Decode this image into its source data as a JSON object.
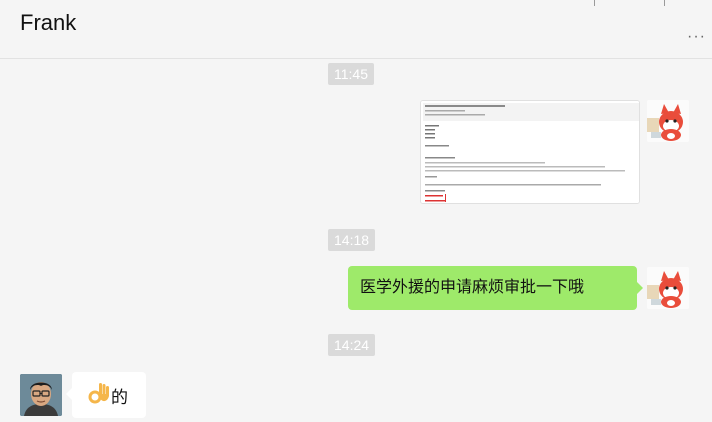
{
  "chat": {
    "title": "Frank",
    "more_icon": "more-dots-icon"
  },
  "messages": [
    {
      "type": "time",
      "text": "11:45"
    },
    {
      "type": "image",
      "from": "me",
      "icon": "document-screenshot-thumbnail"
    },
    {
      "type": "time",
      "text": "14:18"
    },
    {
      "type": "text",
      "from": "me",
      "text": "医学外援的申请麻烦审批一下哦"
    },
    {
      "type": "time",
      "text": "14:24"
    },
    {
      "type": "text",
      "from": "frank",
      "emoji": "ok-hand-emoji",
      "text": "的"
    }
  ],
  "colors": {
    "background": "#f5f5f5",
    "my_bubble": "#9eea6a",
    "their_bubble": "#ffffff",
    "timestamp_bg": "#dadada"
  }
}
